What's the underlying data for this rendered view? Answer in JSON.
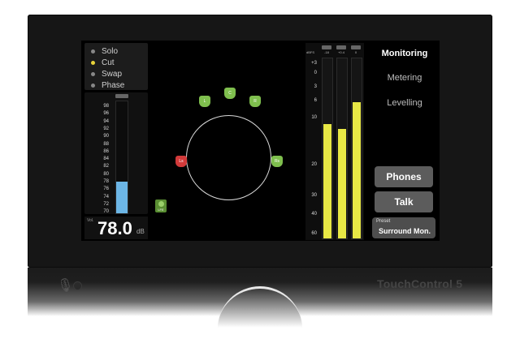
{
  "solo_menu": {
    "items": [
      {
        "label": "Solo",
        "active": false
      },
      {
        "label": "Cut",
        "active": true
      },
      {
        "label": "Swap",
        "active": false
      },
      {
        "label": "Phase",
        "active": false
      }
    ]
  },
  "spl_meter": {
    "header": "SPL",
    "ticks": [
      "98",
      "96",
      "94",
      "92",
      "90",
      "88",
      "86",
      "84",
      "82",
      "80",
      "78",
      "76",
      "74",
      "72",
      "70"
    ],
    "level": 78.0,
    "range": [
      70,
      98
    ],
    "color": "#6cb6e6"
  },
  "volume": {
    "label": "Vol.",
    "value": "78.0",
    "unit": "dB"
  },
  "speakers": [
    {
      "label": "L",
      "state": "on"
    },
    {
      "label": "C",
      "state": "on"
    },
    {
      "label": "R",
      "state": "on"
    },
    {
      "label": "Rs",
      "state": "on"
    },
    {
      "label": "Ls",
      "state": "cut"
    }
  ],
  "lfe": {
    "label": "LFE"
  },
  "level_meters": {
    "unit": "dBFS",
    "scale": [
      "+3",
      "0",
      "3",
      "6",
      "10",
      "20",
      "30",
      "40",
      "60"
    ],
    "channels": [
      {
        "head": "L",
        "sub": "-18",
        "level_db": -11
      },
      {
        "head": "A",
        "sub": "+0.4",
        "level_db": -12
      },
      {
        "head": "R",
        "sub": "0",
        "level_db": -6
      }
    ],
    "color": "#e8e845"
  },
  "nav": {
    "items": [
      {
        "label": "Monitoring",
        "active": true
      },
      {
        "label": "Metering",
        "active": false
      },
      {
        "label": "Levelling",
        "active": false
      }
    ]
  },
  "buttons": {
    "phones": "Phones",
    "talk": "Talk"
  },
  "preset": {
    "label": "Preset",
    "value": "Surround Mon."
  },
  "brand": "TouchControl 5"
}
